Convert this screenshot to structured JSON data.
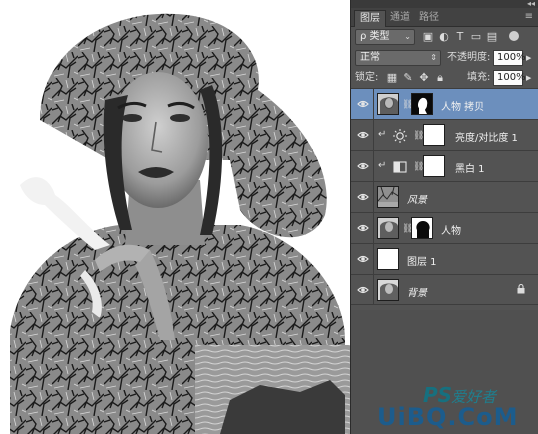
{
  "panel": {
    "collapse_glyph": "◂◂",
    "tabs": [
      {
        "label": "图层",
        "active": true
      },
      {
        "label": "通道",
        "active": false
      },
      {
        "label": "路径",
        "active": false
      }
    ],
    "tab_menu_icon": "panel-menu-icon",
    "filter": {
      "label": "ρ 类型",
      "icons": [
        "pixel-filter-icon",
        "adjustment-filter-icon",
        "type-filter-icon",
        "shape-filter-icon",
        "smart-object-filter-icon"
      ]
    },
    "blend_mode": "正常",
    "opacity_label": "不透明度:",
    "opacity_value": "100%",
    "lock_label": "锁定:",
    "fill_label": "填充:",
    "fill_value": "100%",
    "layers": [
      {
        "name": "人物 拷贝",
        "selected": true,
        "italic": false,
        "type": "pixel-with-mask"
      },
      {
        "name": "亮度/对比度 1",
        "selected": false,
        "italic": false,
        "type": "adjustment-brightness",
        "clipped": true
      },
      {
        "name": "黑白 1",
        "selected": false,
        "italic": false,
        "type": "adjustment-bw",
        "clipped": true
      },
      {
        "name": "风景",
        "selected": false,
        "italic": true,
        "type": "pixel"
      },
      {
        "name": "人物",
        "selected": false,
        "italic": false,
        "type": "pixel-with-mask"
      },
      {
        "name": "图层 1",
        "selected": false,
        "italic": false,
        "type": "white"
      },
      {
        "name": "背景",
        "selected": false,
        "italic": true,
        "type": "background",
        "locked": true
      }
    ]
  },
  "watermark": {
    "ps_text": "PS",
    "cn_text": "爱好者",
    "url_text": "UiBQ.CoM"
  }
}
